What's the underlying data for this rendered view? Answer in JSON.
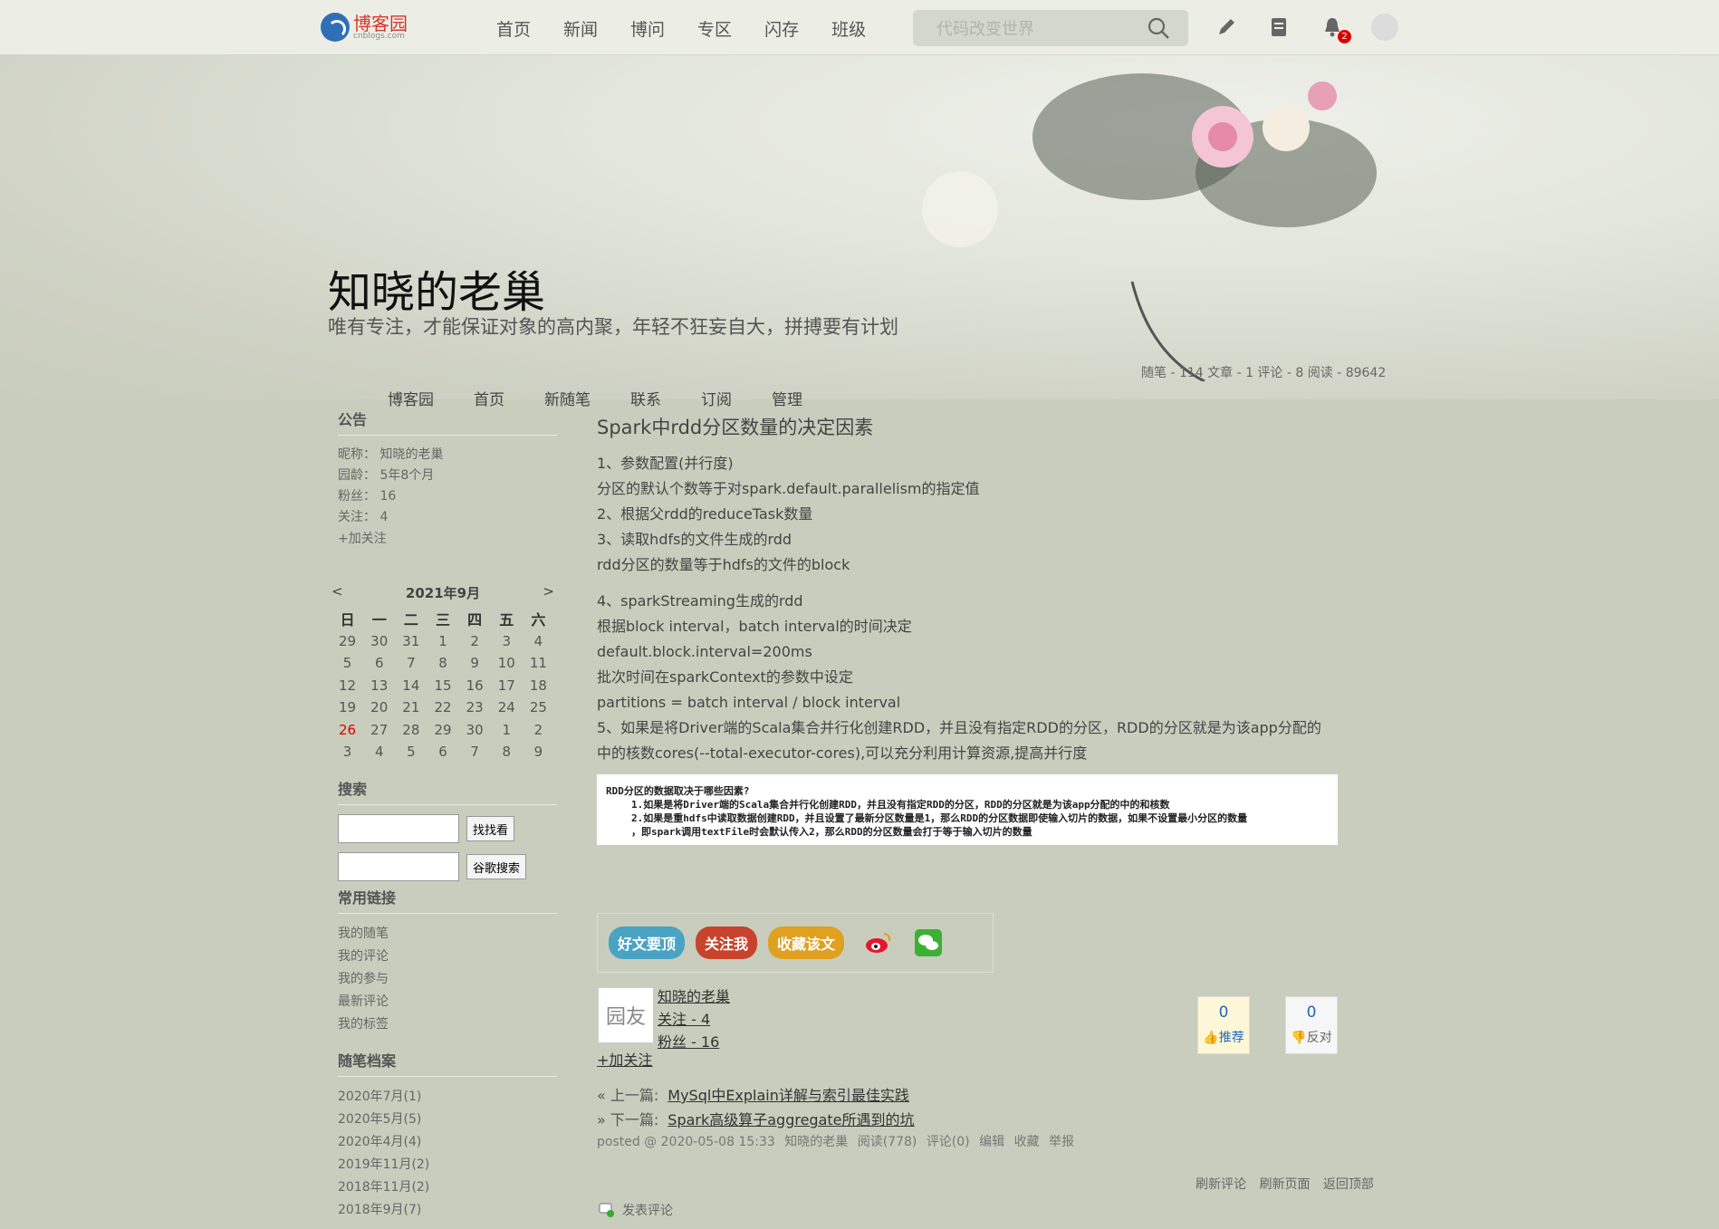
{
  "topbar": {
    "logo_text": "博客园",
    "logo_sub": "cnblogs.com",
    "nav": [
      "首页",
      "新闻",
      "博问",
      "专区",
      "闪存",
      "班级"
    ],
    "search_placeholder": "代码改变世界",
    "notification_count": "2"
  },
  "header": {
    "title": "知晓的老巢",
    "subtitle": "唯有专注，才能保证对象的高内聚，年轻不狂妄自大，拼搏要有计划",
    "stats": "随笔 - 114  文章 - 1  评论 - 8  阅读 - 89642",
    "nav": [
      "博客园",
      "首页",
      "新随笔",
      "联系",
      "订阅",
      "管理"
    ]
  },
  "sidebar": {
    "notice_title": "公告",
    "profile": [
      "昵称：  知晓的老巢",
      "园龄：  5年8个月",
      "粉丝：  16",
      "关注：  4"
    ],
    "add_follow": "+加关注",
    "calendar": {
      "prev": "<",
      "title": "2021年9月",
      "next": ">",
      "weekdays": [
        "日",
        "一",
        "二",
        "三",
        "四",
        "五",
        "六"
      ],
      "weeks": [
        [
          "29",
          "30",
          "31",
          "1",
          "2",
          "3",
          "4"
        ],
        [
          "5",
          "6",
          "7",
          "8",
          "9",
          "10",
          "11"
        ],
        [
          "12",
          "13",
          "14",
          "15",
          "16",
          "17",
          "18"
        ],
        [
          "19",
          "20",
          "21",
          "22",
          "23",
          "24",
          "25"
        ],
        [
          "26",
          "27",
          "28",
          "29",
          "30",
          "1",
          "2"
        ],
        [
          "3",
          "4",
          "5",
          "6",
          "7",
          "8",
          "9"
        ]
      ],
      "today": "26"
    },
    "search_title": "搜索",
    "search_button": "找找看",
    "google_button": "谷歌搜索",
    "links_title": "常用链接",
    "links": [
      "我的随笔",
      "我的评论",
      "我的参与",
      "最新评论",
      "我的标签"
    ],
    "archive_title": "随笔档案",
    "archive": [
      "2020年7月(1)",
      "2020年5月(5)",
      "2020年4月(4)",
      "2019年11月(2)",
      "2018年11月(2)",
      "2018年9月(7)"
    ]
  },
  "post": {
    "title": "Spark中rdd分区数量的决定因素",
    "lines_a": [
      "1、参数配置(并行度)",
      "分区的默认个数等于对spark.default.parallelism的指定值",
      "2、根据父rdd的reduceTask数量",
      "3、读取hdfs的文件生成的rdd",
      "rdd分区的数量等于hdfs的文件的block"
    ],
    "lines_b": [
      "4、sparkStreaming生成的rdd",
      "根据block interval，batch interval的时间决定",
      "default.block.interval=200ms",
      "批次时间在sparkContext的参数中设定",
      "partitions = batch interval / block interval",
      "5、如果是将Driver端的Scala集合并行化创建RDD，并且没有指定RDD的分区，RDD的分区就是为该app分配的",
      "中的核数cores(--total-executor-cores),可以充分利用计算资源,提高并行度"
    ],
    "image_lines": [
      "RDD分区的数据取决于哪些因素?",
      "1.如果是将Driver端的Scala集合并行化创建RDD，并且没有指定RDD的分区，RDD的分区就是为该app分配的中的和核数",
      "2.如果是重hdfs中读取数据创建RDD，并且设置了最新分区数量是1，那么RDD的分区数据即使输入切片的数据，如果不设置最小分区的数量",
      "，即spark调用textFile时会默认传入2，那么RDD的分区数量会打于等于输入切片的数量"
    ],
    "share": {
      "digg": "好文要顶",
      "follow": "关注我",
      "favorite": "收藏该文"
    },
    "author": {
      "name": "知晓的老巢",
      "following": "关注 - 4",
      "followers": "粉丝 - 16",
      "avatar_text": "园友",
      "add_follow": "+加关注"
    },
    "votes": {
      "up_count": "0",
      "up_label": "推荐",
      "down_count": "0",
      "down_label": "反对"
    },
    "prev_label": "« 上一篇:",
    "prev_title": "MySql中Explain详解与索引最佳实践",
    "next_label": "» 下一篇:",
    "next_title": "Spark高级算子aggregate所遇到的坑",
    "meta": {
      "posted": "posted @ 2020-05-08 15:33",
      "author": "知晓的老巢",
      "reads": "阅读(778)",
      "comments": "评论(0)",
      "edit": "编辑",
      "favorite": "收藏",
      "report": "举报"
    },
    "bottom_links": [
      "刷新评论",
      "刷新页面",
      "返回顶部"
    ],
    "comment_link": "发表评论"
  },
  "colors": {
    "accent_red": "#d8342b",
    "digg_pill": "#4ba3c4",
    "follow_pill": "#c8432c",
    "favorite_pill": "#e0a020"
  }
}
